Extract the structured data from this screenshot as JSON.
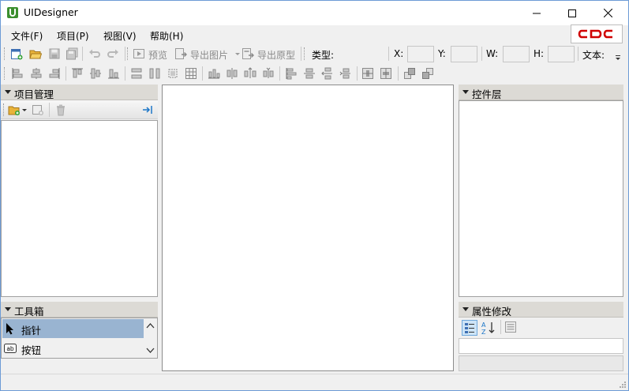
{
  "window": {
    "title": "UIDesigner",
    "controls": {
      "minimize": "minimize",
      "maximize": "maximize",
      "close": "close"
    }
  },
  "menu": {
    "items": [
      "文件(F)",
      "项目(P)",
      "视图(V)",
      "帮助(H)"
    ],
    "logo_text": "CDC",
    "logo_color": "#d00000"
  },
  "toolbar1": {
    "preview": "预览",
    "export_image": "导出图片",
    "export_prototype": "导出原型",
    "type_label": "类型:",
    "x_label": "X:",
    "y_label": "Y:",
    "w_label": "W:",
    "h_label": "H:",
    "text_label": "文本:",
    "x_value": "",
    "y_value": "",
    "w_value": "",
    "h_value": ""
  },
  "panels": {
    "project": {
      "title": "项目管理"
    },
    "toolbox": {
      "title": "工具箱",
      "items": [
        {
          "label": "指针",
          "icon": "pointer-icon",
          "selected": true
        },
        {
          "label": "按钮",
          "icon": "button-ab-icon",
          "selected": false
        }
      ]
    },
    "layers": {
      "title": "控件层"
    },
    "properties": {
      "title": "属性修改"
    }
  },
  "colors": {
    "selection": "#99b4d1",
    "accent": "#1c76c8",
    "panel_header": "#dcdad5"
  }
}
